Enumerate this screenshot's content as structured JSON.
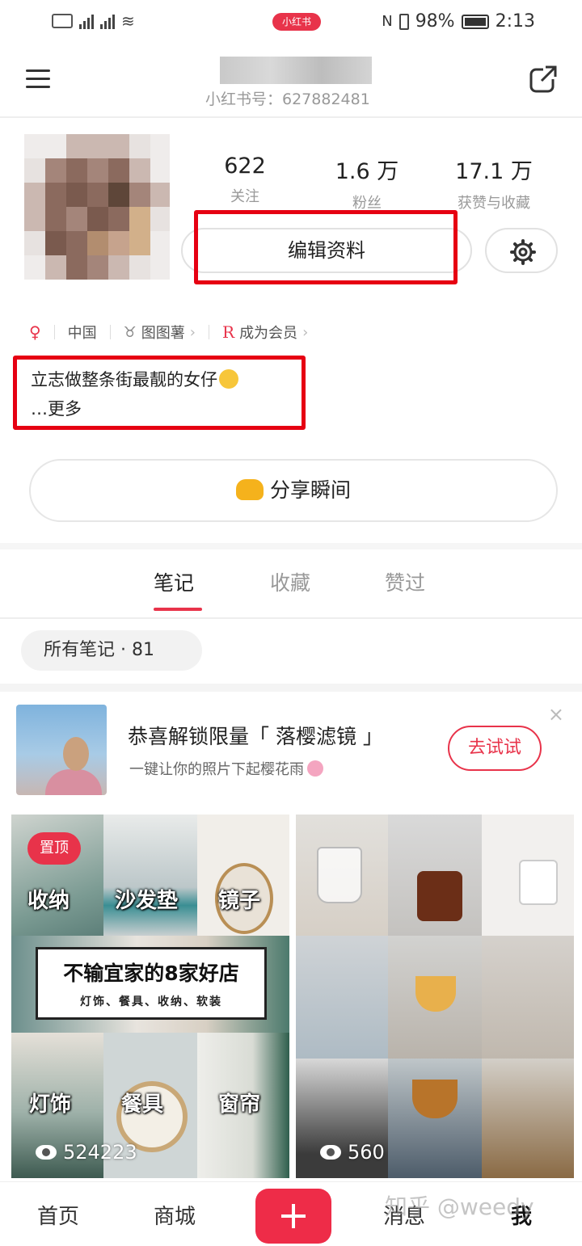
{
  "status_bar": {
    "battery": "98%",
    "time": "2:13",
    "chip": "小红书"
  },
  "header": {
    "user_id": "小红书号：627882481",
    "menu_icon": "hamburger-menu-icon",
    "share_icon": "share-external-icon"
  },
  "profile": {
    "stats": [
      {
        "value": "622",
        "label": "关注"
      },
      {
        "value": "1.6 万",
        "label": "粉丝"
      },
      {
        "value": "17.1 万",
        "label": "获赞与收藏"
      }
    ],
    "edit_button": "编辑资料",
    "tags": {
      "location": "中国",
      "zodiac": "图图薯",
      "member": "成为会员"
    },
    "bio_line": "立志做整条街最靓的女仔",
    "bio_more": "…更多",
    "share_moment": "分享瞬间"
  },
  "tabs": [
    {
      "label": "笔记",
      "active": true
    },
    {
      "label": "收藏",
      "active": false
    },
    {
      "label": "赞过",
      "active": false
    }
  ],
  "filter": {
    "label": "所有笔记 · 81"
  },
  "promo": {
    "title": "恭喜解锁限量「 落樱滤镜 」",
    "subtitle": "一键让你的照片下起樱花雨",
    "button": "去试试",
    "close": "×"
  },
  "notes": [
    {
      "pinned_label": "置顶",
      "categories": [
        "收纳",
        "沙发垫",
        "镜子",
        "灯饰",
        "餐具",
        "窗帘"
      ],
      "banner_title": "不输宜家的8家好店",
      "banner_sub": "灯饰、餐具、收纳、软装",
      "views": "524223"
    },
    {
      "views": "560"
    }
  ],
  "bottom_nav": {
    "home": "首页",
    "mall": "商城",
    "messages": "消息",
    "me": "我"
  },
  "watermark": "知乎 @weedy",
  "colors": {
    "accent": "#e8334a",
    "highlight_box": "#e60012"
  }
}
